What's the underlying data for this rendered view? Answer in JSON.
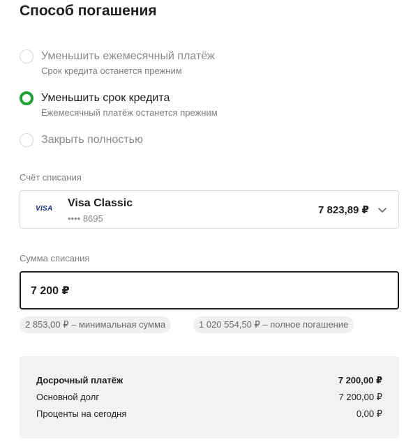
{
  "title": "Способ погашения",
  "options": [
    {
      "label": "Уменьшить ежемесячный платёж",
      "sub": "Срок кредита останется прежним",
      "checked": false
    },
    {
      "label": "Уменьшить срок кредита",
      "sub": "Ежемесячный платёж останется прежним",
      "checked": true
    },
    {
      "label": "Закрыть полностью",
      "sub": "",
      "checked": false
    }
  ],
  "account": {
    "label": "Счёт списания",
    "logo": "VISA",
    "name": "Visa Classic",
    "number": "•••• 8695",
    "balance": "7 823,89 ₽",
    "chevron_icon": "chevron-down-icon"
  },
  "amount": {
    "label": "Сумма списания",
    "value": "7 200 ₽"
  },
  "chips": [
    {
      "text": "2 853,00 ₽ – минимальная сумма"
    },
    {
      "text": "1 020 554,50 ₽ – полное погашение"
    }
  ],
  "summary": [
    {
      "label": "Досрочный платёж",
      "value": "7 200,00 ₽"
    },
    {
      "label": "Основной долг",
      "value": "7 200,00 ₽"
    },
    {
      "label": "Проценты на сегодня",
      "value": "0,00 ₽"
    }
  ],
  "colors": {
    "accent": "#21a038",
    "text": "#1f1f1f",
    "muted": "#7d7d7d",
    "summary_bg": "#f2f2f2"
  }
}
